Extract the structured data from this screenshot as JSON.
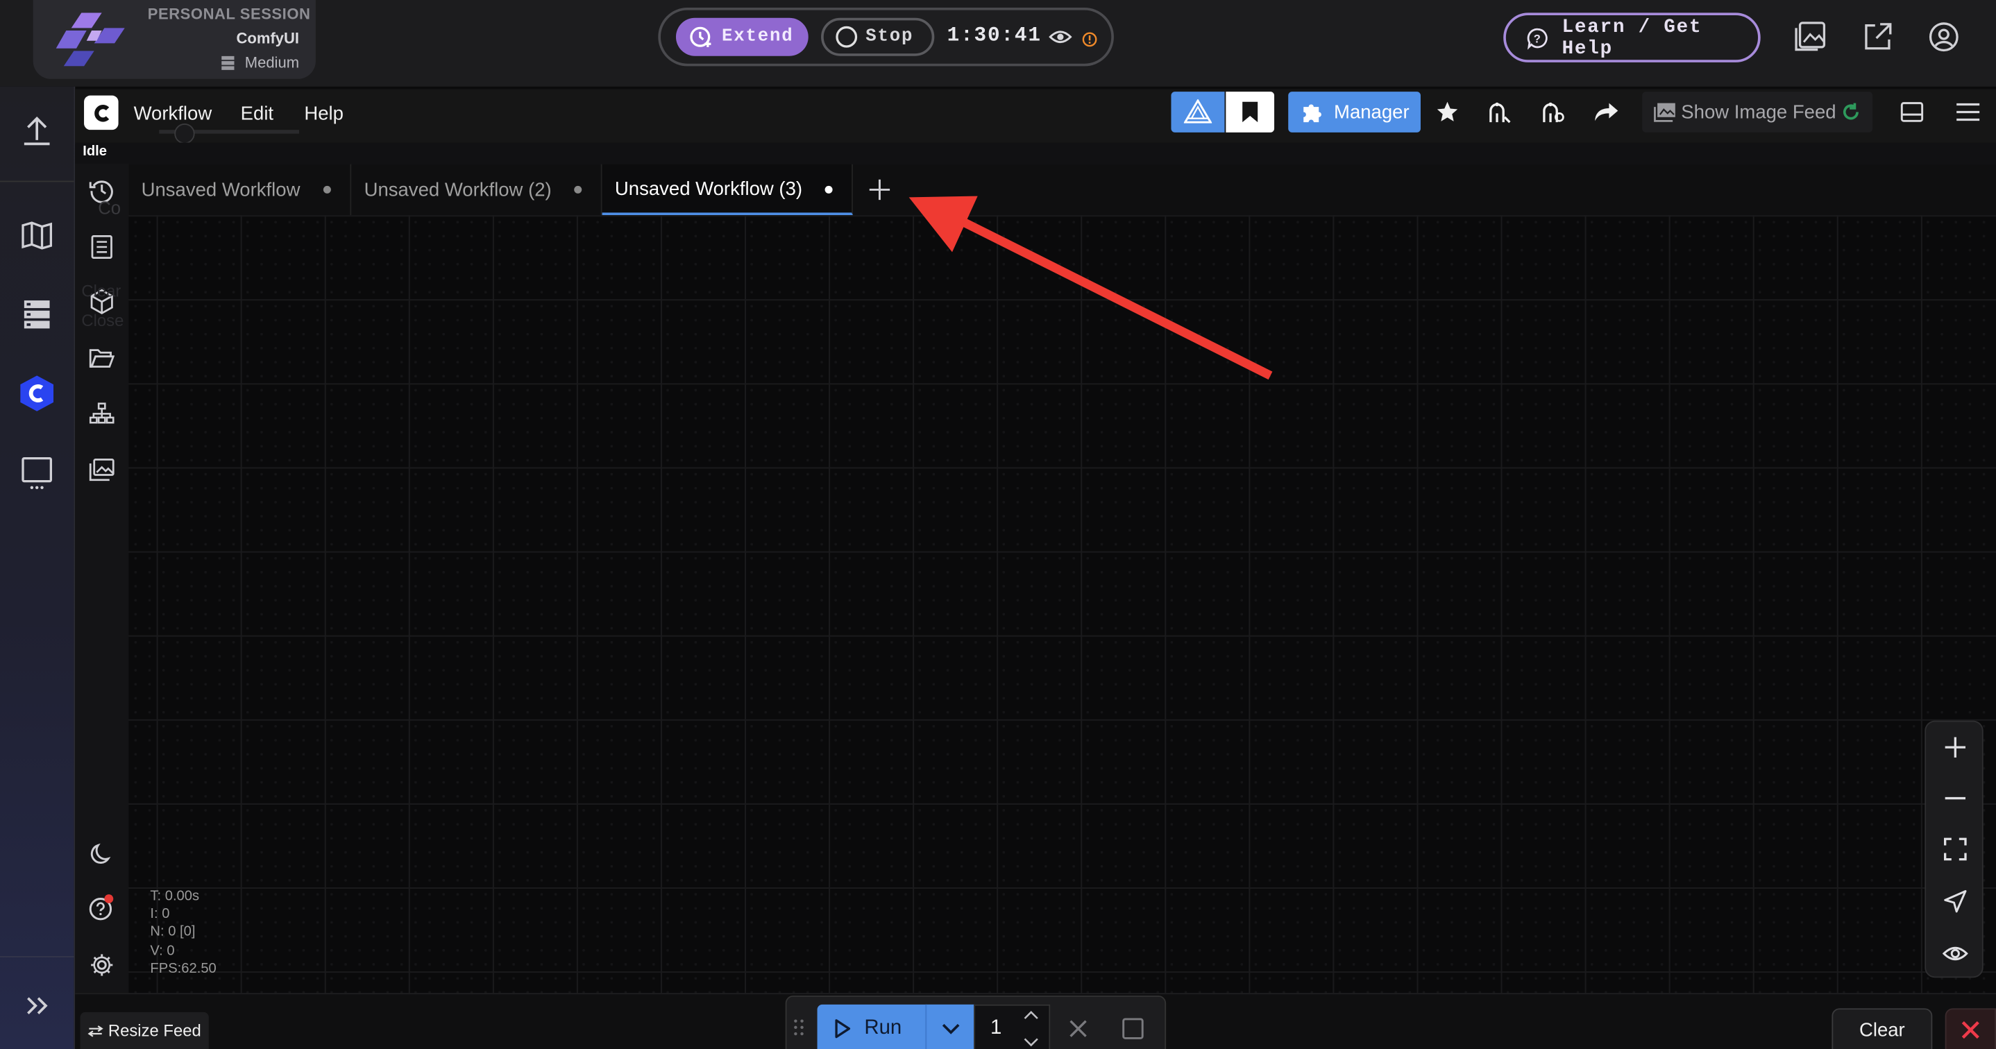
{
  "session": {
    "label": "PERSONAL SESSION",
    "app_name": "ComfyUI",
    "tier": "Medium",
    "extend_label": "Extend",
    "stop_label": "Stop",
    "timer": "1:30:41",
    "learn_label": "Learn / Get Help"
  },
  "menu": {
    "items": [
      "Workflow",
      "Edit",
      "Help"
    ],
    "status": "Idle"
  },
  "toolbar": {
    "manager_label": "Manager",
    "image_feed_label": "Show Image Feed"
  },
  "tabs": [
    {
      "label": "Unsaved Workflow",
      "active": false
    },
    {
      "label": "Unsaved Workflow (2)",
      "active": false
    },
    {
      "label": "Unsaved Workflow (3)",
      "active": true
    }
  ],
  "ghost_text": [
    "Co",
    "Clear",
    "Close"
  ],
  "stats": {
    "t": "T: 0.00s",
    "i": "I: 0",
    "n": "N: 0 [0]",
    "v": "V: 0",
    "fps": "FPS:62.50"
  },
  "bottom": {
    "resize_feed_label": "Resize Feed",
    "run_label": "Run",
    "batch_count": "1",
    "clear_label": "Clear"
  },
  "colors": {
    "accent_blue": "#4f8fe6",
    "accent_purple": "#9b7ad8",
    "annotation_arrow": "#ef3a32",
    "logo_blue": "#2a44f0"
  },
  "icons": {
    "left_rail": [
      "upload-icon",
      "book-icon",
      "server-icon",
      "comfy-logo-icon",
      "monitor-icon",
      "expand-double-chevron-icon"
    ],
    "side_panel": [
      "history-icon",
      "queue-list-icon",
      "model-cube-icon",
      "folder-icon",
      "node-tree-icon",
      "image-gallery-icon",
      "moon-icon",
      "help-icon",
      "settings-gear-icon"
    ],
    "canvas_controls": [
      "zoom-in-icon",
      "zoom-out-icon",
      "fit-view-icon",
      "locate-icon",
      "visibility-eye-icon"
    ]
  }
}
